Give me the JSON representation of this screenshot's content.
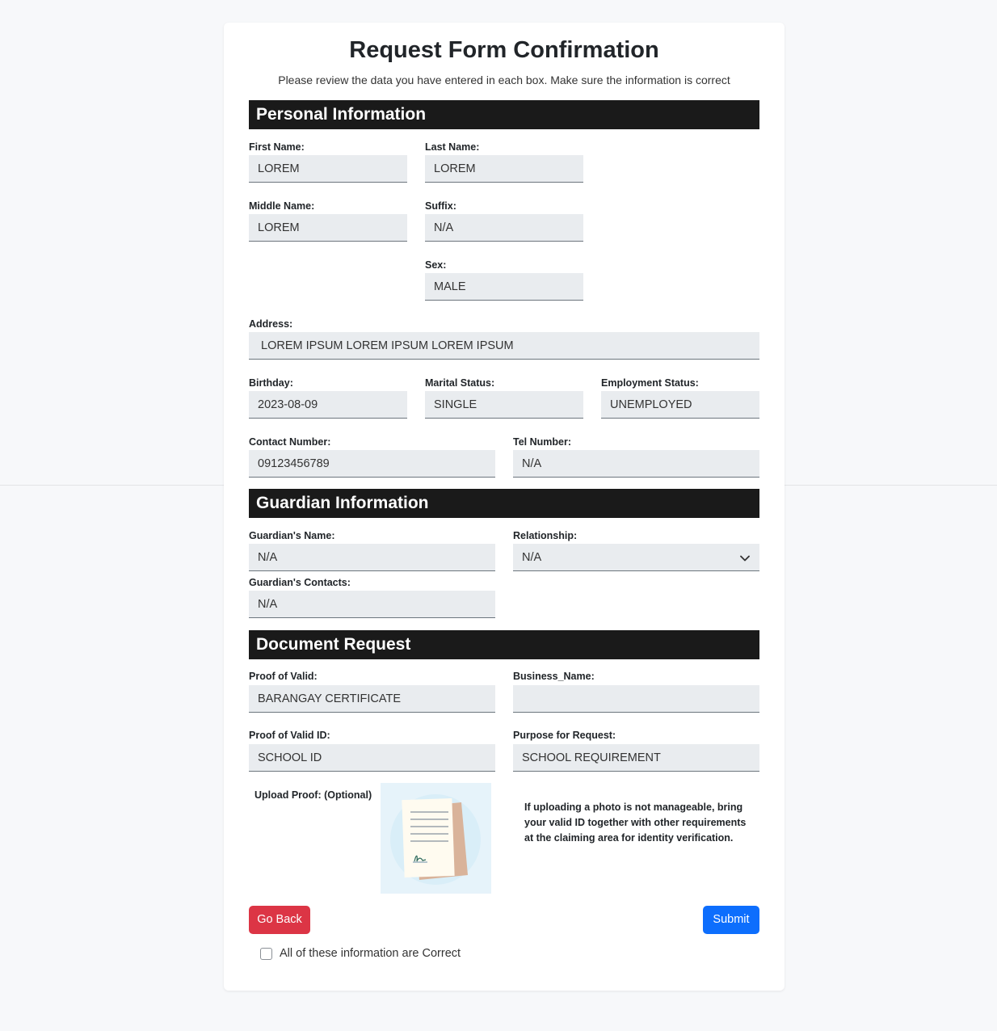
{
  "header": {
    "title": "Request Form Confirmation",
    "subtitle": "Please review the data you have entered in each box. Make sure the information is correct"
  },
  "personal": {
    "heading": "Personal Information",
    "first_name": {
      "label": "First Name:",
      "value": "LOREM"
    },
    "last_name": {
      "label": "Last Name:",
      "value": "LOREM"
    },
    "middle_name": {
      "label": "Middle Name:",
      "value": "LOREM"
    },
    "suffix": {
      "label": "Suffix:",
      "value": "N/A"
    },
    "sex": {
      "label": "Sex:",
      "value": "MALE"
    },
    "address": {
      "label": "Address:",
      "value": "LOREM IPSUM LOREM IPSUM LOREM IPSUM"
    },
    "birthday": {
      "label": "Birthday:",
      "value": "2023-08-09"
    },
    "marital_status": {
      "label": "Marital Status:",
      "value": "SINGLE"
    },
    "employment_status": {
      "label": "Employment Status:",
      "value": "UNEMPLOYED"
    },
    "contact_number": {
      "label": "Contact Number:",
      "value": "09123456789"
    },
    "tel_number": {
      "label": "Tel Number:",
      "value": "N/A"
    }
  },
  "guardian": {
    "heading": "Guardian Information",
    "name": {
      "label": "Guardian's Name:",
      "value": "N/A"
    },
    "relationship": {
      "label": "Relationship:",
      "value": "N/A"
    },
    "contacts": {
      "label": "Guardian's Contacts:",
      "value": "N/A"
    }
  },
  "document": {
    "heading": "Document Request",
    "proof_of_valid": {
      "label": "Proof of Valid:",
      "value": "BARANGAY CERTIFICATE"
    },
    "business_name": {
      "label": "Business_Name:",
      "value": ""
    },
    "proof_of_valid_id": {
      "label": "Proof of Valid ID:",
      "value": "SCHOOL ID"
    },
    "purpose": {
      "label": "Purpose for Request:",
      "value": "SCHOOL REQUIREMENT"
    },
    "upload_label": "Upload Proof: (Optional)",
    "note": "If uploading a photo is not manageable, bring your valid ID together with other requirements at the claiming area for identity verification."
  },
  "actions": {
    "back_label": "Go Back",
    "submit_label": "Submit",
    "confirm_label": "All of these information are Correct",
    "confirm_checked": false
  },
  "icons": {
    "upload_preview": "document-signed-icon",
    "select_arrow": "chevron-down-icon"
  },
  "colors": {
    "section_bar": "#1a1a1a",
    "back_button": "#dc3545",
    "submit_button": "#0d6efd",
    "field_bg": "#e9ecef"
  }
}
